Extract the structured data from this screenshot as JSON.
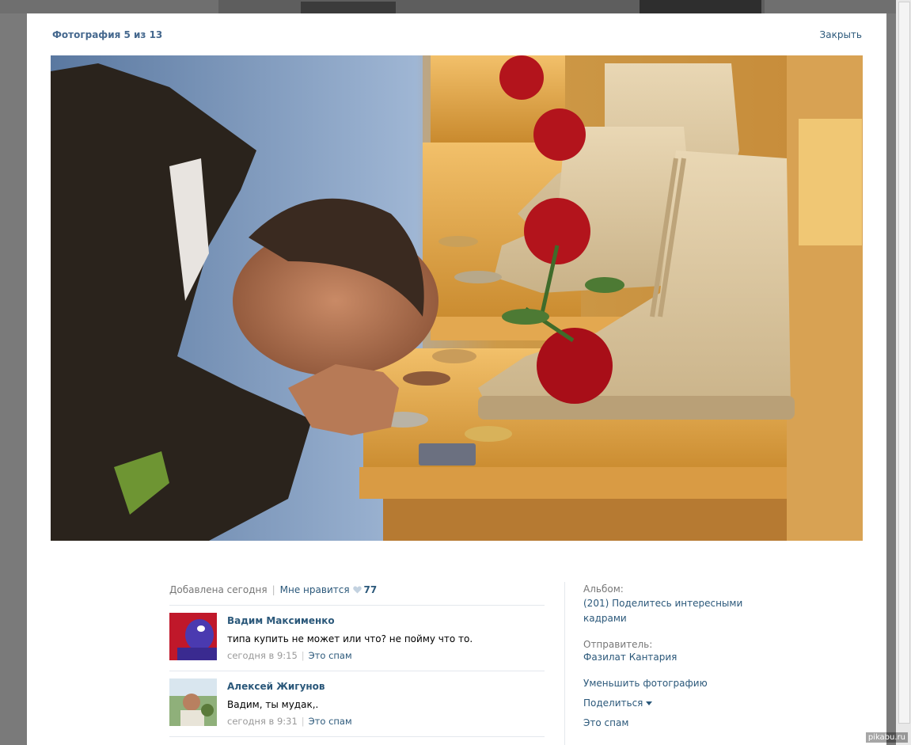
{
  "header": {
    "counter": "Фотография 5 из 13",
    "close_label": "Закрыть"
  },
  "photo_meta": {
    "added": "Добавлена сегодня",
    "like_label": "Мне нравится",
    "like_count": "77"
  },
  "comments": [
    {
      "author": "Вадим Максименко",
      "text": "типа купить не может или что? не пойму что то.",
      "date": "сегодня в 9:15",
      "spam": "Это спам"
    },
    {
      "author": "Алексей Жигунов",
      "text": "Вадим, ты мудак,.",
      "date": "сегодня в 9:31",
      "spam": "Это спам"
    }
  ],
  "sidebar": {
    "album_label": "Альбом:",
    "album_name": "(201) Поделитесь интересными кадрами",
    "sender_label": "Отправитель:",
    "sender_name": "Фазилат Кантария",
    "reduce_photo": "Уменьшить фотографию",
    "share": "Поделиться",
    "spam": "Это спам"
  },
  "watermark": "pikabu.ru",
  "colors": {
    "link": "#2b587a",
    "title": "#45688e",
    "muted": "#777777",
    "overlay": "#7a7a7a"
  }
}
